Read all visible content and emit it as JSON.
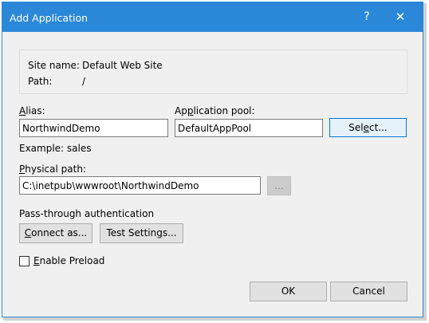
{
  "window": {
    "title": "Add Application",
    "help_glyph": "?",
    "close_glyph": "✕"
  },
  "info": {
    "site_name_label": "Site name:",
    "site_name_value": "Default Web Site",
    "path_label": "Path:",
    "path_value": "/"
  },
  "alias": {
    "label_mnemonic": "A",
    "label_rest": "lias:",
    "value": "NorthwindDemo",
    "example": "Example: sales"
  },
  "app_pool": {
    "label_pre": "Ap",
    "label_mnemonic": "p",
    "label_rest": "lication pool:",
    "value": "DefaultAppPool",
    "select_pre": "Sel",
    "select_mnemonic": "e",
    "select_rest": "ct..."
  },
  "physical_path": {
    "label_mnemonic": "P",
    "label_rest": "hysical path:",
    "value": "C:\\inetpub\\wwwroot\\NorthwindDemo",
    "browse_label": "..."
  },
  "auth": {
    "heading": "Pass-through authentication",
    "connect_mnemonic": "C",
    "connect_rest": "onnect as...",
    "test_pre": "Test Settin",
    "test_mnemonic": "g",
    "test_rest": "s..."
  },
  "preload": {
    "checked": false,
    "label_mnemonic": "E",
    "label_rest": "nable Preload"
  },
  "footer": {
    "ok_label": "OK",
    "cancel_label": "Cancel"
  }
}
